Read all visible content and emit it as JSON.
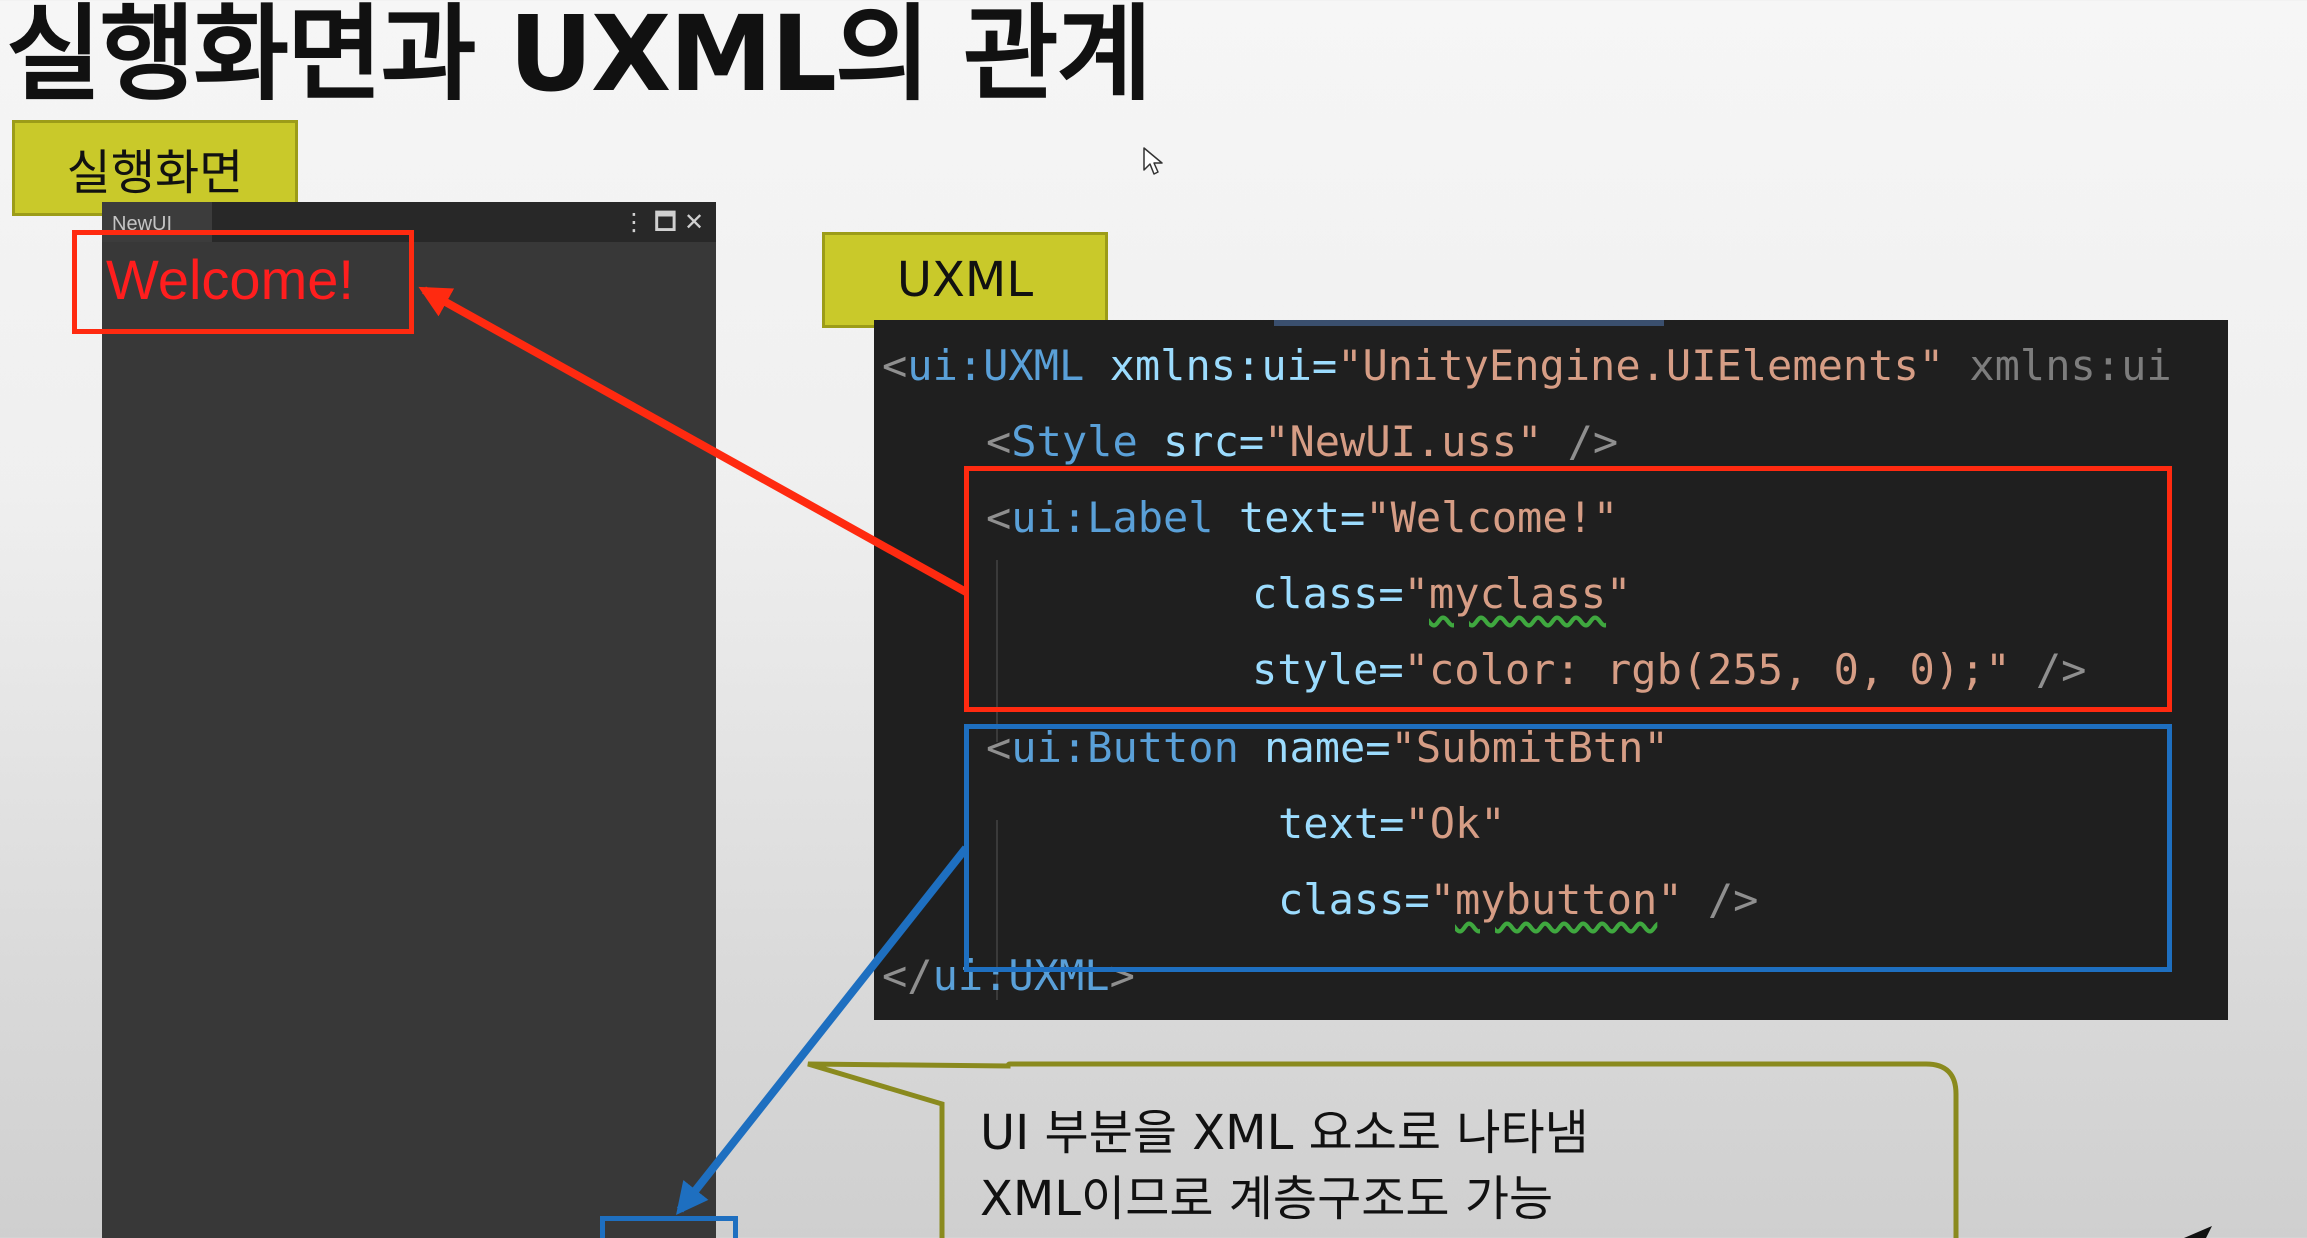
{
  "slide": {
    "title": "실행화면과 UXML의 관계"
  },
  "tags": {
    "runtime": "실행화면",
    "uxml": "UXML"
  },
  "unity_window": {
    "tab_title": "NewUI",
    "menu_icon": "kebab-menu-icon",
    "maximize_icon": "maximize-icon",
    "close_icon": "close-icon",
    "welcome_label": "Welcome!"
  },
  "code": {
    "line1": {
      "open": "<",
      "tag": "ui:UXML",
      "attr1": " xmlns:ui=",
      "val1": "\"UnityEngine.UIElements\"",
      "rest": " xmlns:ui"
    },
    "line2": {
      "open": "<",
      "tag": "Style",
      "attr": " src=",
      "val": "\"NewUI.uss\"",
      "close": " />"
    },
    "line3": {
      "open": "<",
      "tag": "ui:Label",
      "attr": " text=",
      "val": "\"Welcome!\""
    },
    "line4": {
      "attr": "class=",
      "q1": "\"",
      "val": "myclass",
      "q2": "\""
    },
    "line5": {
      "attr": "style=",
      "val": "\"color: rgb(255, 0, 0);\"",
      "close": " />"
    },
    "line6": {
      "open": "<",
      "tag": "ui:Button",
      "attr": " name=",
      "val": "\"SubmitBtn\""
    },
    "line7": {
      "attr": "text=",
      "val": "\"Ok\""
    },
    "line8": {
      "attr": "class=",
      "q1": "\"",
      "val": "mybutton",
      "q2": "\"",
      "close": " />"
    },
    "line9": {
      "open": "</",
      "tag": "ui:UXML",
      "close": ">"
    }
  },
  "callout": {
    "line1": "UI 부분을 XML 요소로 나타냄",
    "line2": "XML이므로 계층구조도 가능"
  },
  "colors": {
    "label_highlight": "#ff2a10",
    "button_highlight": "#1e6fc0",
    "tag_fill": "#c9c92a",
    "callout_border": "#8a8a1e"
  },
  "icons": {
    "cursor": "mouse-pointer-icon"
  }
}
